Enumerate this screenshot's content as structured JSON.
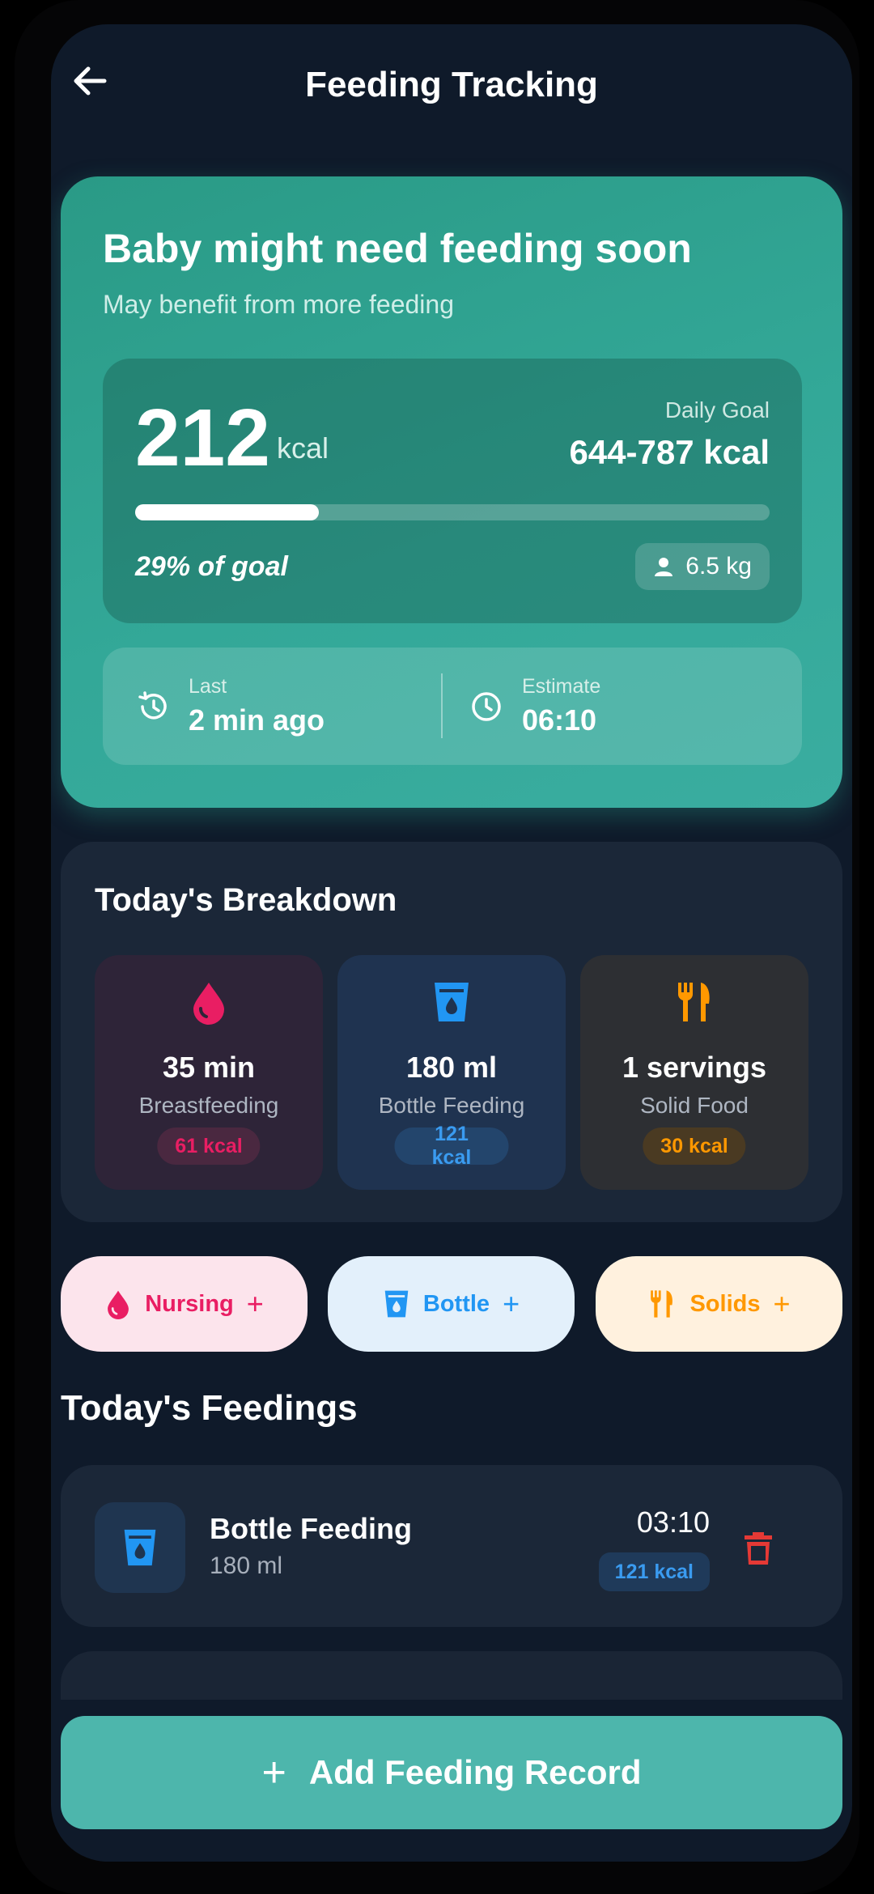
{
  "header": {
    "title": "Feeding Tracking",
    "back_icon": "arrow-left-icon"
  },
  "status_card": {
    "headline": "Baby might need feeding soon",
    "subtitle": "May benefit from more feeding",
    "calories": "212",
    "calories_unit": "kcal",
    "goal_label": "Daily Goal",
    "goal_value": "644-787 kcal",
    "progress_fraction": 0.29,
    "percent_text": "29%  of goal",
    "weight": "6.5 kg",
    "last_label": "Last",
    "last_value": "2 min ago",
    "estimate_label": "Estimate",
    "estimate_value": "06:10"
  },
  "breakdown": {
    "title": "Today's Breakdown",
    "items": [
      {
        "value": "35 min",
        "label": "Breastfeeding",
        "kcal": "61 kcal",
        "icon": "droplet-icon",
        "color": "#e91e63"
      },
      {
        "value": "180 ml",
        "label": "Bottle Feeding",
        "kcal": "121 kcal",
        "icon": "bottle-icon",
        "color": "#2196f3"
      },
      {
        "value": "1 servings",
        "label": "Solid Food",
        "kcal": "30 kcal",
        "icon": "utensils-icon",
        "color": "#ff9800"
      }
    ]
  },
  "quick_add": [
    {
      "label": "Nursing",
      "color": "#e91e63",
      "bg": "#fce4ec"
    },
    {
      "label": "Bottle",
      "color": "#2196f3",
      "bg": "#e3f0fb"
    },
    {
      "label": "Solids",
      "color": "#ff9800",
      "bg": "#fff1de"
    }
  ],
  "feedings": {
    "title": "Today's Feedings",
    "entries": [
      {
        "name": "Bottle Feeding",
        "amount": "180 ml",
        "time": "03:10",
        "kcal": "121 kcal"
      }
    ]
  },
  "add_button": {
    "label": "Add Feeding Record"
  }
}
